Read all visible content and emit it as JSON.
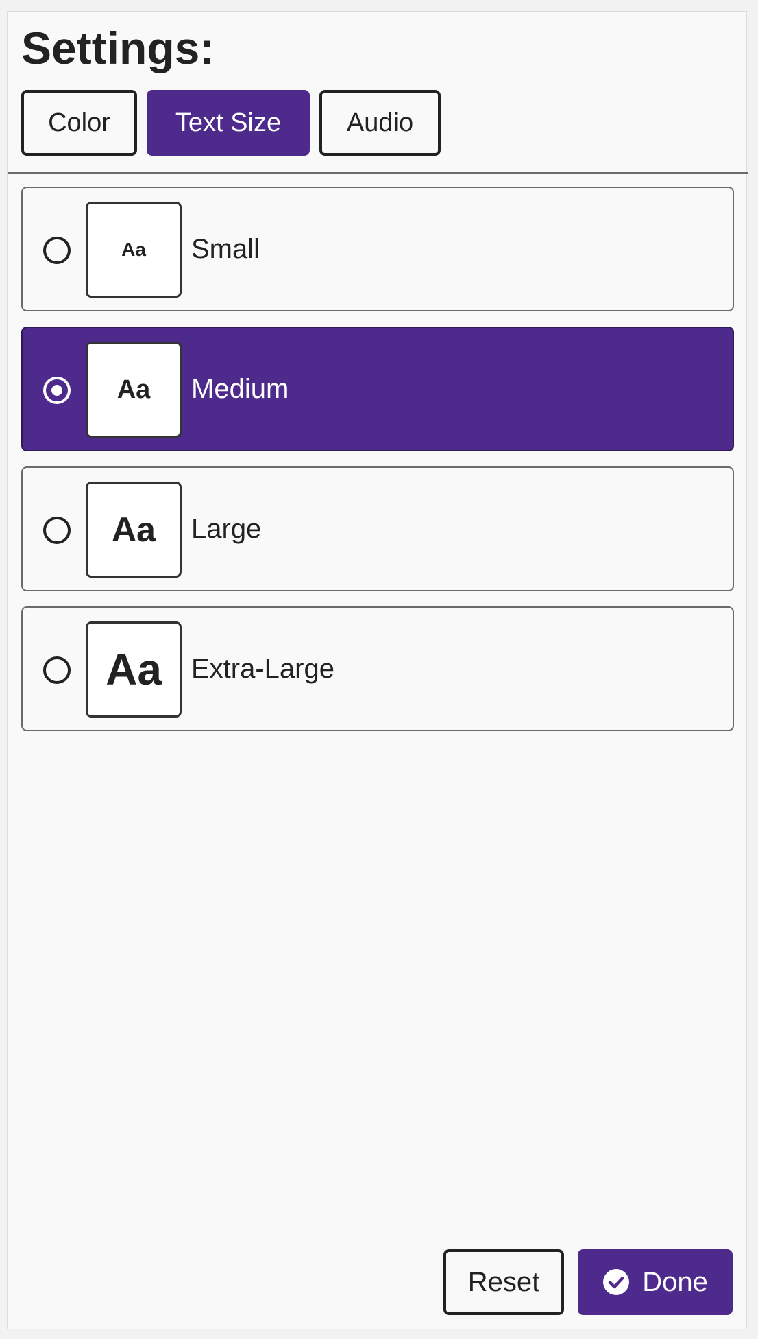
{
  "header": {
    "title": "Settings:"
  },
  "tabs": [
    {
      "label": "Color",
      "active": false
    },
    {
      "label": "Text Size",
      "active": true
    },
    {
      "label": "Audio",
      "active": false
    }
  ],
  "text_size": {
    "selected": "Medium",
    "options": [
      {
        "label": "Small",
        "preview": "Aa"
      },
      {
        "label": "Medium",
        "preview": "Aa"
      },
      {
        "label": "Large",
        "preview": "Aa"
      },
      {
        "label": "Extra-Large",
        "preview": "Aa"
      }
    ]
  },
  "footer": {
    "reset_label": "Reset",
    "done_label": "Done",
    "done_icon": "check-circle-icon"
  },
  "colors": {
    "accent": "#4e2a8c",
    "background": "#f9f9f9",
    "text": "#222222"
  }
}
